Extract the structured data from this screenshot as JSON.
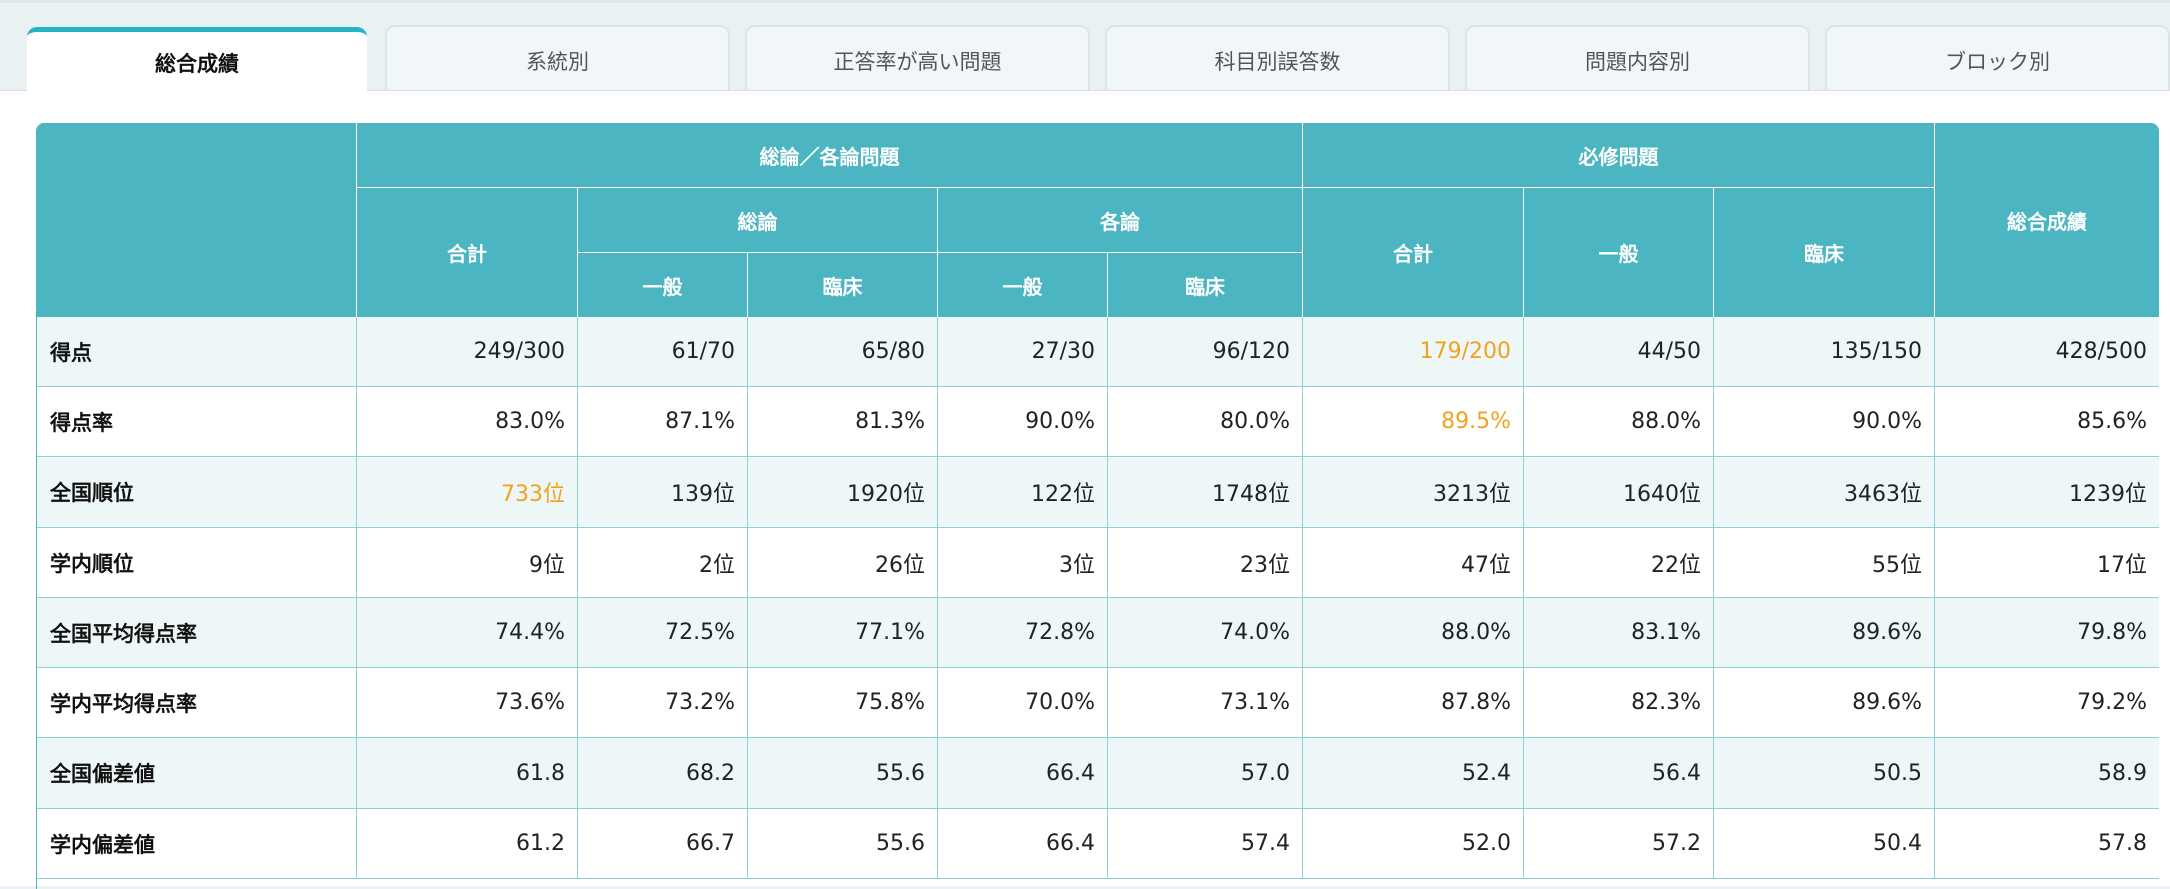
{
  "tabs": [
    "総合成績",
    "系統別",
    "正答率が高い問題",
    "科目別誤答数",
    "問題内容別",
    "ブロック別"
  ],
  "active_tab": "総合成績",
  "table": {
    "group_headers": {
      "general_specific": "総論／各論問題",
      "required": "必修問題",
      "overall": "総合成績"
    },
    "sub_headers": {
      "total": "合計",
      "general": "総論",
      "specific": "各論",
      "required_total": "合計",
      "required_ippan": "一般",
      "required_rinsho": "臨床"
    },
    "leaf_headers": {
      "general_ippan": "一般",
      "general_rinsho": "臨床",
      "specific_ippan": "一般",
      "specific_rinsho": "臨床"
    },
    "highlight_color": "#f2a21f",
    "header_color": "#4bb5c1",
    "rows": [
      {
        "label": "得点",
        "values": [
          "249/300",
          "61/70",
          "65/80",
          "27/30",
          "96/120",
          "179/200",
          "44/50",
          "135/150",
          "428/500"
        ],
        "highlight": [
          5
        ]
      },
      {
        "label": "得点率",
        "values": [
          "83.0%",
          "87.1%",
          "81.3%",
          "90.0%",
          "80.0%",
          "89.5%",
          "88.0%",
          "90.0%",
          "85.6%"
        ],
        "highlight": [
          5
        ]
      },
      {
        "label": "全国順位",
        "values": [
          "733位",
          "139位",
          "1920位",
          "122位",
          "1748位",
          "3213位",
          "1640位",
          "3463位",
          "1239位"
        ],
        "highlight": [
          0
        ]
      },
      {
        "label": "学内順位",
        "values": [
          "9位",
          "2位",
          "26位",
          "3位",
          "23位",
          "47位",
          "22位",
          "55位",
          "17位"
        ],
        "highlight": []
      },
      {
        "label": "全国平均得点率",
        "values": [
          "74.4%",
          "72.5%",
          "77.1%",
          "72.8%",
          "74.0%",
          "88.0%",
          "83.1%",
          "89.6%",
          "79.8%"
        ],
        "highlight": []
      },
      {
        "label": "学内平均得点率",
        "values": [
          "73.6%",
          "73.2%",
          "75.8%",
          "70.0%",
          "73.1%",
          "87.8%",
          "82.3%",
          "89.6%",
          "79.2%"
        ],
        "highlight": []
      },
      {
        "label": "全国偏差値",
        "values": [
          "61.8",
          "68.2",
          "55.6",
          "66.4",
          "57.0",
          "52.4",
          "56.4",
          "50.5",
          "58.9"
        ],
        "highlight": []
      },
      {
        "label": "学内偏差値",
        "values": [
          "61.2",
          "66.7",
          "55.6",
          "66.4",
          "57.4",
          "52.0",
          "57.2",
          "50.4",
          "57.8"
        ],
        "highlight": []
      }
    ]
  }
}
